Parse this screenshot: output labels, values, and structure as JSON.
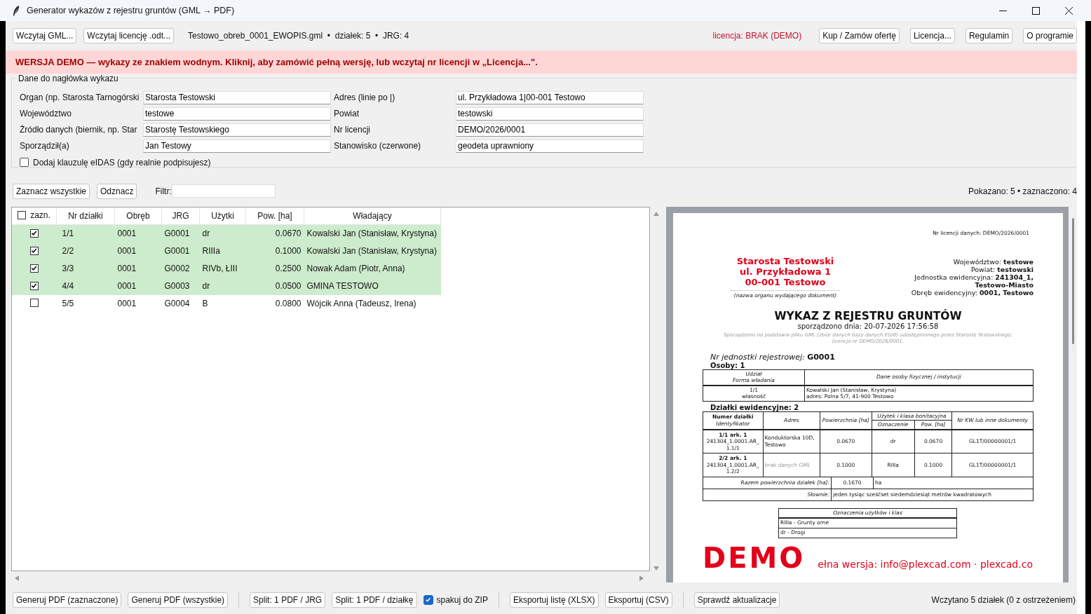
{
  "window": {
    "title": "Generator wykazów z rejestru gruntów (GML → PDF)"
  },
  "toolbar": {
    "buttons_left": [
      "Wczytaj GML...",
      "Wczytaj licencję .odt..."
    ],
    "file_info": "Testowo_obreb_0001_EWOPIS.gml  •  działek: 5  •  JRG: 4",
    "license_status": "licencja: BRAK (DEMO)",
    "buttons_right": [
      "Kup / Zamów ofertę",
      "Licencja...",
      "Regulamin",
      "O programie"
    ]
  },
  "banner": "WERSJA DEMO — wykazy ze znakiem wodnym. Kliknij, aby zamówić pełną wersję, lub wczytaj nr licencji w „Licencja...\".",
  "header_form": {
    "title": "Dane do nagłówka wykazu",
    "fields": [
      {
        "label": "Organ (np. Starosta Tarnogórski",
        "value": "Starosta Testowski"
      },
      {
        "label": "Adres (linie po |)",
        "value": "ul. Przykładowa 1|00-001 Testowo"
      },
      {
        "label": "Województwo",
        "value": "testowe"
      },
      {
        "label": "Powiat",
        "value": "testowski"
      },
      {
        "label": "Źródło danych (biernik, np. Star",
        "value": "Starostę Testowskiego"
      },
      {
        "label": "Nr licencji",
        "value": "DEMO/2026/0001"
      },
      {
        "label": "Sporządził(a)",
        "value": "Jan Testowy"
      },
      {
        "label": "Stanowisko (czerwone)",
        "value": "geodeta uprawniony"
      }
    ],
    "eidas": {
      "label": "Dodaj klauzulę eIDAS (gdy realnie podpisujesz)",
      "checked": false
    }
  },
  "selection_bar": {
    "buttons": [
      "Zaznacz wszystkie",
      "Odznacz"
    ],
    "filter_label": "Filtr:",
    "summary": "Pokazano: 5 • zaznaczono: 4"
  },
  "table": {
    "header_checked": false,
    "check_column": "zazn.",
    "columns": [
      "Nr działki",
      "Obręb",
      "JRG",
      "Użytki",
      "Pow. [ha]",
      "Władający"
    ],
    "rows": [
      {
        "checked": true,
        "cells": [
          "1/1",
          "0001",
          "G0001",
          "dr",
          "0.0670",
          "Kowalski Jan (Stanisław, Krystyna)"
        ]
      },
      {
        "checked": true,
        "cells": [
          "2/2",
          "0001",
          "G0001",
          "RIIIa",
          "0.1000",
          "Kowalski Jan (Stanisław, Krystyna)"
        ]
      },
      {
        "checked": true,
        "cells": [
          "3/3",
          "0001",
          "G0002",
          "RIVb, ŁIII",
          "0.2500",
          "Nowak Adam (Piotr, Anna)"
        ]
      },
      {
        "checked": true,
        "cells": [
          "4/4",
          "0001",
          "G0003",
          "dr",
          "0.0500",
          "GMINA TESTOWO"
        ]
      },
      {
        "checked": false,
        "cells": [
          "5/5",
          "0001",
          "G0004",
          "B",
          "0.0800",
          "Wójcik Anna (Tadeusz, Irena)"
        ]
      }
    ]
  },
  "preview": {
    "license_line": "Nr licencji danych: DEMO/2026/0001",
    "organ_lines": [
      "Starosta Testowski",
      "ul. Przykładowa 1",
      "00-001 Testowo"
    ],
    "organ_caption": "(nazwa organu wydającego dokument)",
    "region_lines": [
      {
        "label": "Województwo:",
        "value": "testowe"
      },
      {
        "label": "Powiat:",
        "value": "testowski"
      },
      {
        "label": "Jednostka ewidencyjna:",
        "value": "241304_1,"
      },
      {
        "value": "Testowo-Miasto"
      },
      {
        "label": "Obręb ewidencyjny:",
        "value": "0001, Testowo"
      }
    ],
    "title": "WYKAZ Z REJESTRU GRUNTÓW",
    "date_line": "sporządzono dnia: 20-07-2026 17:56:58",
    "note": "Sporządzono na podstawie pliku GML (zbiór danych bazy danych EGiB) udostępnionego przez Starostę Testowskiego; licencja nr DEMO/2026/0001.",
    "unit_label": "Nr jednostki rejestrowej:",
    "unit_value": "G0001",
    "persons": "Osoby: 1",
    "owners": {
      "headers": [
        [
          "Udział",
          "Forma władania"
        ],
        [
          "Dane osoby fizycznej / instytucji"
        ]
      ],
      "rows": [
        [
          [
            "1/1",
            "własność"
          ],
          [
            "Kowalski Jan (Stanisław, Krystyna)",
            "adres: Polna 5/7, 41-900 Testowo"
          ]
        ]
      ]
    },
    "parcels_heading": "Działki ewidencyjne: 2",
    "parcels": {
      "headers": {
        "number": "Numer działki",
        "identifier": "Identyfikator",
        "address": "Adres",
        "area": "Powierzchnia [ha]",
        "use_group": "Użytek i klasa bonitacyjna",
        "use": "Oznaczenie",
        "use_area": "Pow. [ha]",
        "kw": "Nr KW lub inne dokumenty"
      },
      "rows": [
        {
          "number": "1/1 ark. 1",
          "identifier": "241304_1.0001.AR_1.1/1",
          "address": "Konduktorska 10D, Testowo",
          "missing": false,
          "area": "0.0670",
          "use": "dr",
          "use_area": "0.0670",
          "kw": "GL1T/00000001/1"
        },
        {
          "number": "2/2 ark. 1",
          "identifier": "241304_1.0001.AR_1.2/2",
          "address": "brak danych GML",
          "missing": true,
          "area": "0.1000",
          "use": "RIIIa",
          "use_area": "0.1000",
          "kw": "GL1T/00000001/1"
        }
      ]
    },
    "total_label": "Razem powierzchnia działek [ha]:",
    "total_value": "0.1670",
    "total_unit": "ha",
    "words_label": "Słownie:",
    "words_value": "jeden tysiąc sześćset siedemdziesiąt metrów kwadratowych",
    "legend": {
      "title": "Oznaczenia użytków i klas",
      "items": [
        "RIIIa - Grunty orne",
        "dr - Drogi"
      ]
    },
    "watermark": "DEMO",
    "watermark_line": "ełna wersja: info@plexcad.com · plexcad.co"
  },
  "bottom_bar": {
    "items": [
      {
        "kind": "button",
        "label": "Generuj PDF (zaznaczone)"
      },
      {
        "kind": "button",
        "label": "Generuj PDF (wszystkie)"
      },
      {
        "kind": "separator"
      },
      {
        "kind": "button",
        "label": "Split: 1 PDF / JRG"
      },
      {
        "kind": "button",
        "label": "Split: 1 PDF / działkę"
      },
      {
        "kind": "checkbox",
        "label": "spakuj do ZIP",
        "checked": true
      },
      {
        "kind": "separator"
      },
      {
        "kind": "button",
        "label": "Eksportuj listę (XLSX)"
      },
      {
        "kind": "button",
        "label": "Eksportuj (CSV)"
      },
      {
        "kind": "separator"
      },
      {
        "kind": "button",
        "label": "Sprawdź aktualizacje"
      }
    ],
    "status": "Wczytano 5 działek (0 z ostrzeżeniem)"
  }
}
